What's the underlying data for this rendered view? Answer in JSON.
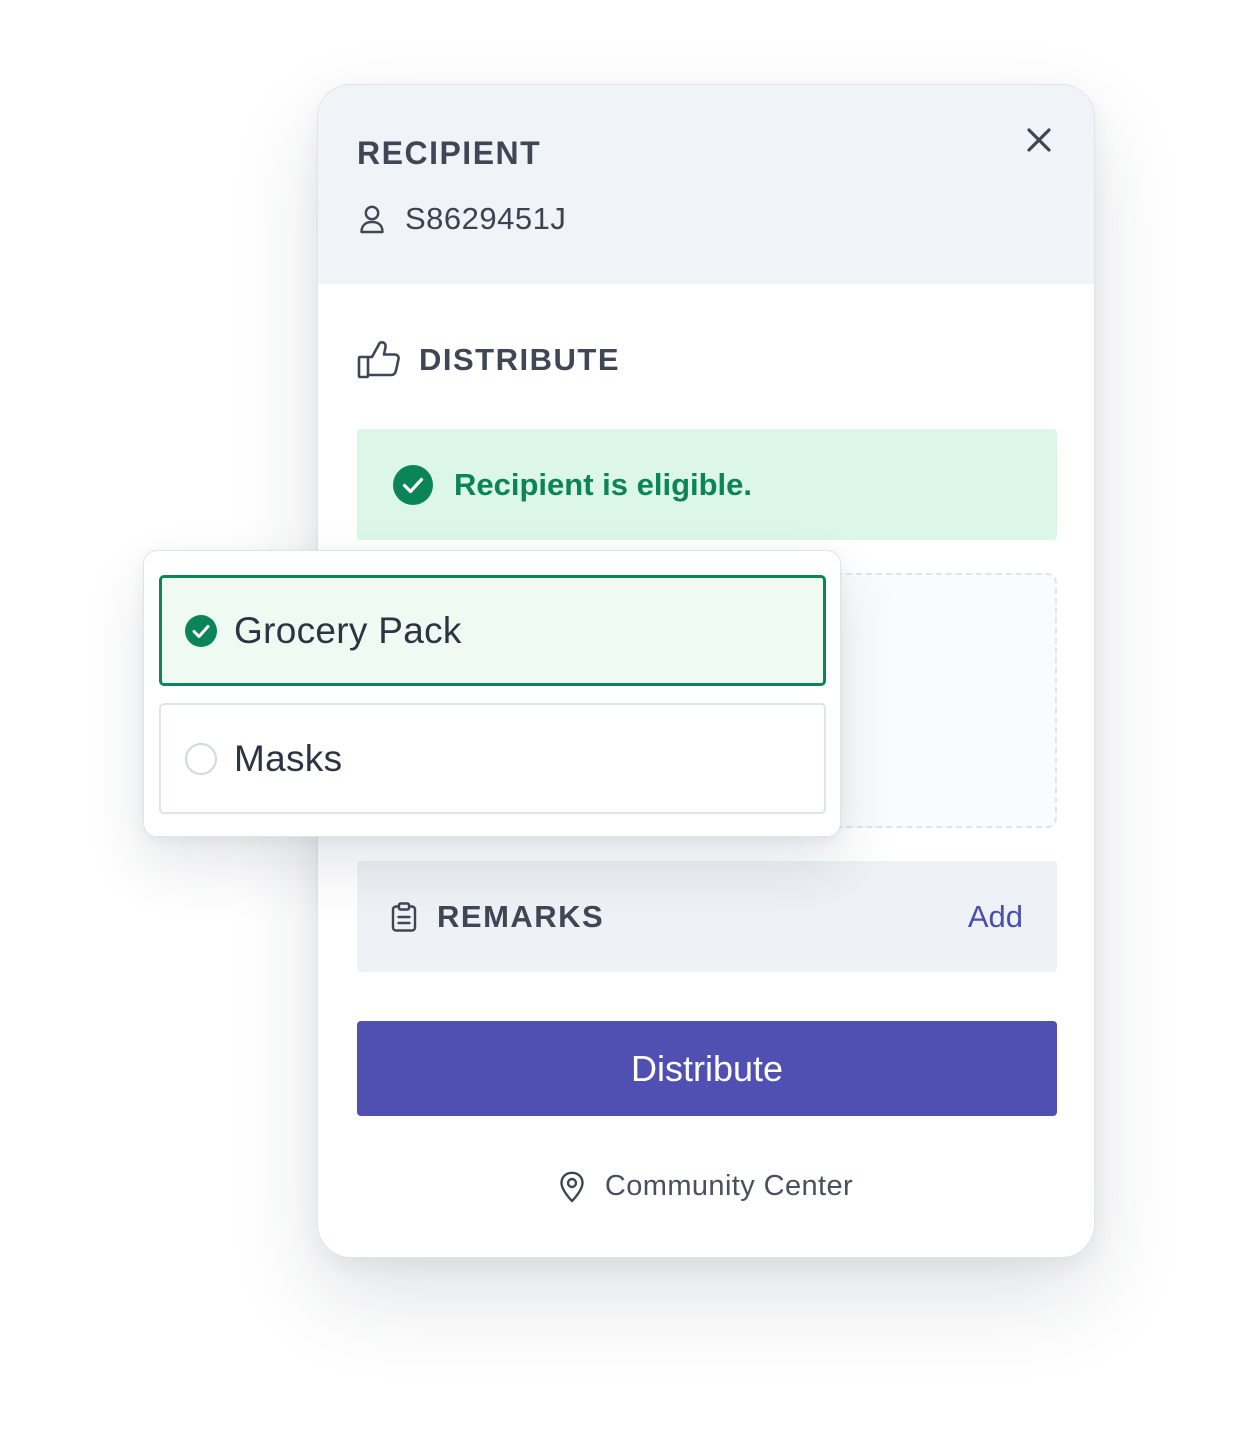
{
  "header": {
    "title": "RECIPIENT",
    "recipient_id": "S8629451J"
  },
  "distribute_section": {
    "title": "DISTRIBUTE",
    "eligibility_message": "Recipient is eligible."
  },
  "item_options": [
    {
      "label": "Grocery Pack",
      "selected": true
    },
    {
      "label": "Masks",
      "selected": false
    }
  ],
  "remarks": {
    "label": "REMARKS",
    "action_label": "Add"
  },
  "primary_action": {
    "label": "Distribute"
  },
  "location": {
    "label": "Community Center"
  },
  "colors": {
    "accent": "#5050b2",
    "success": "#0a8458",
    "success_bg": "#dcf6e8",
    "header_bg": "#f0f3f8"
  },
  "icons": {
    "close": "close-icon",
    "recipient": "user-icon",
    "distribute": "thumbs-up-icon",
    "eligible": "check-circle-icon",
    "remarks": "clipboard-icon",
    "location": "map-pin-icon"
  }
}
